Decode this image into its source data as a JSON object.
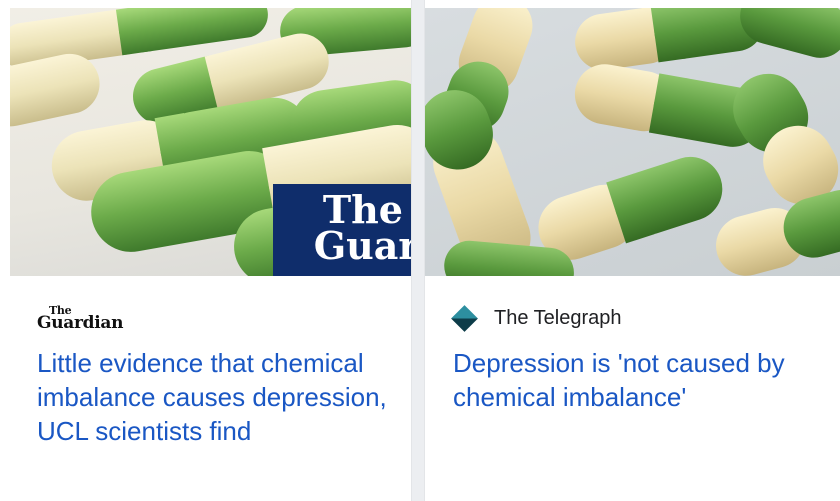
{
  "cards": [
    {
      "image_alt": "Green and cream capsules",
      "image_badge": {
        "line1": "The",
        "line2": "Guard"
      },
      "source": {
        "the": "The",
        "name": "Guardian"
      },
      "headline": "Little evidence that chemical imbalance causes depression, UCL scientists find"
    },
    {
      "image_alt": "Green and cream capsules",
      "source": {
        "name": "The Telegraph"
      },
      "headline": "Depression is 'not caused by chemical imbalance'"
    }
  ],
  "colors": {
    "headline": "#1a57c4",
    "guardian_badge": "#0f2d6b",
    "capsule_green": "#6cab4a",
    "capsule_cream": "#ece3b8"
  }
}
